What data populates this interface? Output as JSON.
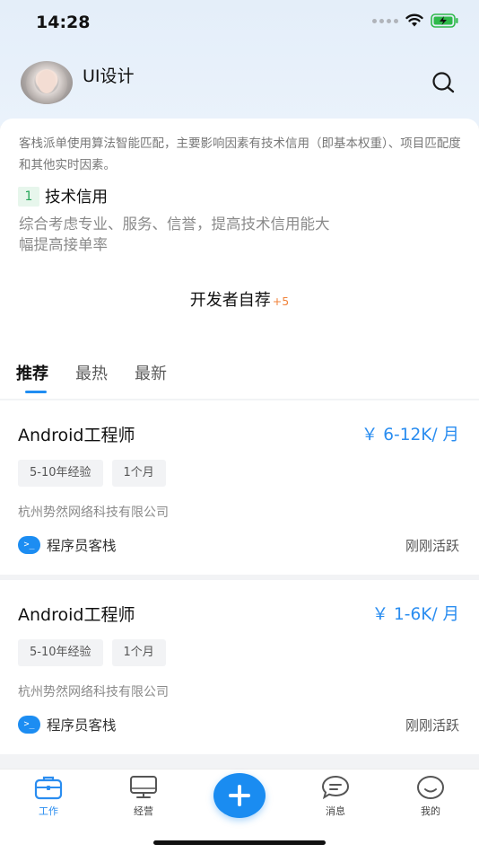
{
  "status_bar": {
    "time": "14:28"
  },
  "header": {
    "username": "UI设计"
  },
  "panel": {
    "description": "客栈派单使用算法智能匹配，主要影响因素有技术信用（即基本权重）、项目匹配度和其他实时因素。",
    "criteria": {
      "number": "1",
      "title": "技术信用",
      "description": "综合考虑专业、服务、信誉，提高技术信用能大幅提高接单率"
    },
    "self_recommend": {
      "title": "开发者自荐",
      "count": "+5"
    },
    "tabs": [
      {
        "label": "推荐"
      },
      {
        "label": "最热"
      },
      {
        "label": "最新"
      }
    ]
  },
  "jobs": [
    {
      "title": "Android工程师",
      "salary": "￥ 6-12K/ 月",
      "tags": [
        "5-10年经验",
        "1个月"
      ],
      "company": "杭州势然网络科技有限公司",
      "platform": "程序员客栈",
      "status": "刚刚活跃"
    },
    {
      "title": "Android工程师",
      "salary": "￥ 1-6K/ 月",
      "tags": [
        "5-10年经验",
        "1个月"
      ],
      "company": "杭州势然网络科技有限公司",
      "platform": "程序员客栈",
      "status": "刚刚活跃"
    }
  ],
  "bottom_nav": {
    "items": [
      {
        "label": "工作"
      },
      {
        "label": "经营"
      },
      {
        "label": "消息"
      },
      {
        "label": "我的"
      }
    ]
  },
  "colors": {
    "accent": "#1a8cf1",
    "badge_green": "#27a75a",
    "count_orange": "#f0823a"
  }
}
